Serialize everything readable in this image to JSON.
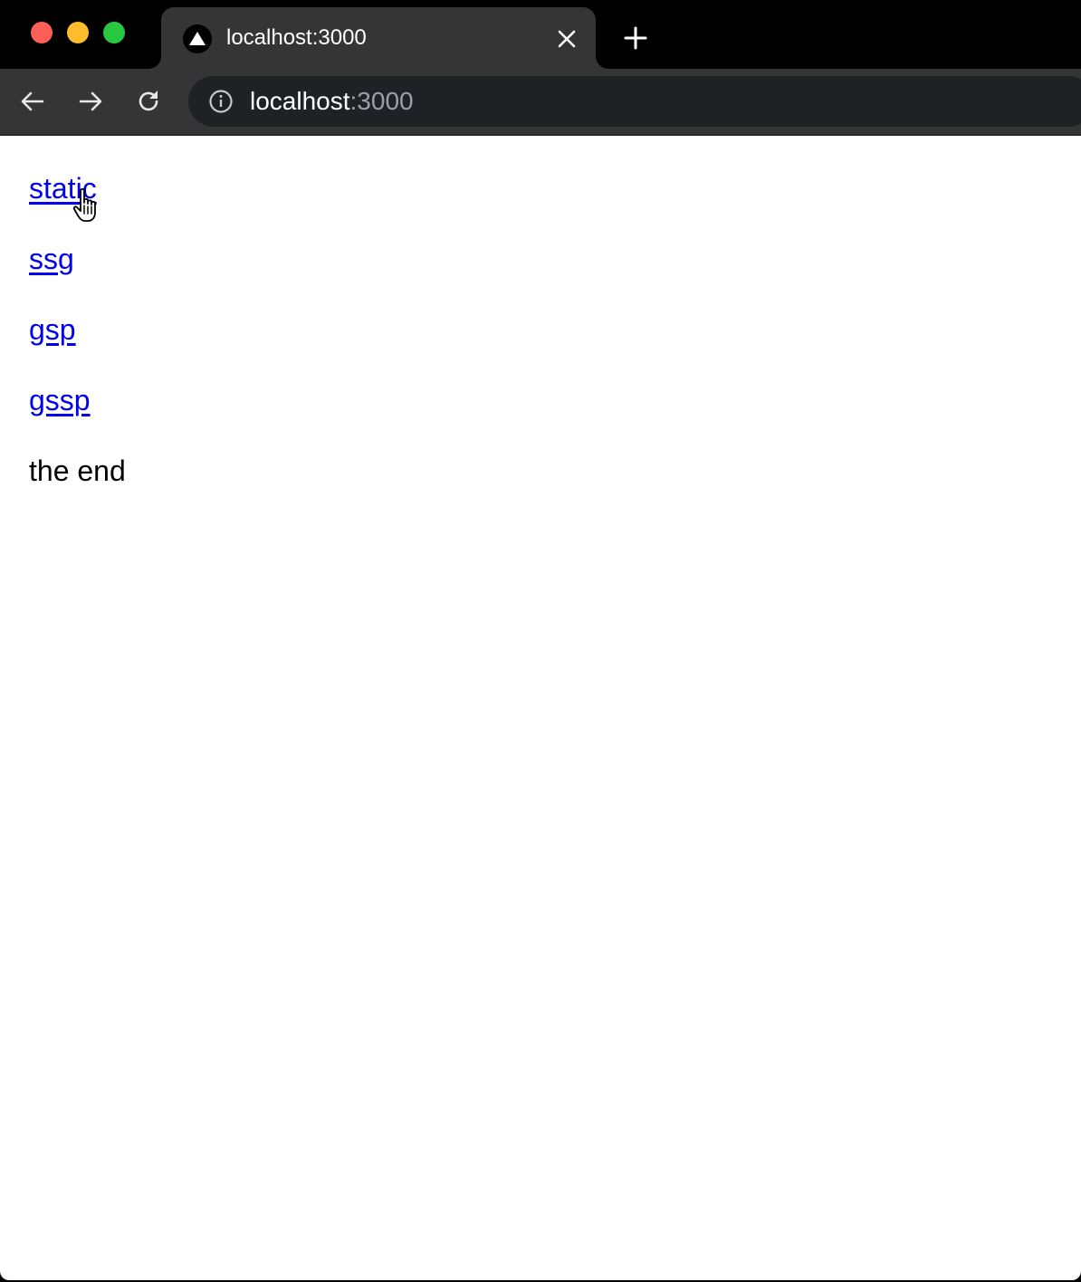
{
  "browser": {
    "tab": {
      "title": "localhost:3000",
      "favicon": "triangle-icon"
    },
    "address_bar": {
      "host": "localhost",
      "port": ":3000"
    },
    "colors": {
      "chrome_dark": "#353535",
      "omnibox": "#202124",
      "link": "#0000ee"
    }
  },
  "page": {
    "links": [
      {
        "label": "static"
      },
      {
        "label": "ssg"
      },
      {
        "label": "gsp"
      },
      {
        "label": "gssp"
      }
    ],
    "footer_text": "the end"
  }
}
